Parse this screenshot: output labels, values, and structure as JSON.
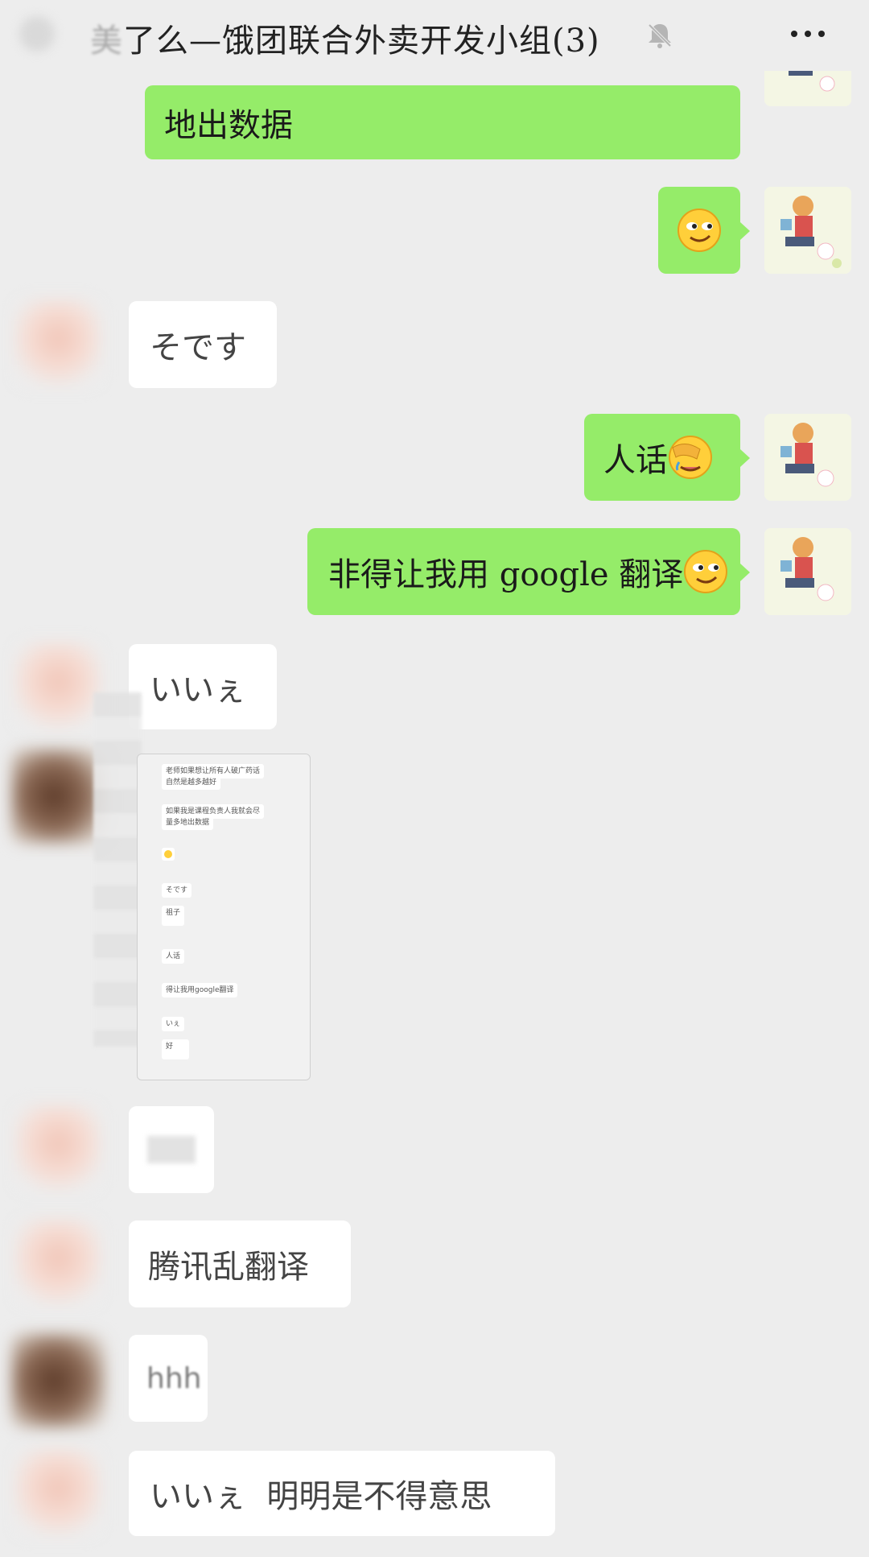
{
  "header": {
    "title_blurred_prefix": "美",
    "title_rest": "了么—饿团联合外卖开发小组(3)",
    "mute_icon": "bell-mute-icon",
    "more_icon": "more-icon"
  },
  "messages": [
    {
      "side": "right",
      "text": "地出数据"
    },
    {
      "side": "right",
      "text": "",
      "emoji": "smirk-emoji"
    },
    {
      "side": "left",
      "text": "そです"
    },
    {
      "side": "right",
      "text": "人话",
      "emoji": "facepalm-emoji"
    },
    {
      "side": "right",
      "text": "非得让我用 google 翻译",
      "emoji": "smirk-emoji"
    },
    {
      "side": "left",
      "text": "いいぇ"
    },
    {
      "side": "left",
      "type": "image"
    },
    {
      "side": "left",
      "text": ""
    },
    {
      "side": "left",
      "text": "腾讯乱翻译"
    },
    {
      "side": "left",
      "text": "hhh"
    },
    {
      "side": "left",
      "text": "いいぇ  明明是不得意思"
    }
  ],
  "screenshot_card": {
    "lines": [
      "老师如果想让所有人破广药话",
      "自然是越多越好",
      "如果我是课程负责人我就会尽",
      "量多地出数据",
      "そです",
      "祖子",
      "人话",
      "得让我用google翻译",
      "いぇ",
      "好"
    ]
  },
  "colors": {
    "background": "#ededed",
    "bubble_self": "#95ec69",
    "bubble_other": "#ffffff"
  }
}
